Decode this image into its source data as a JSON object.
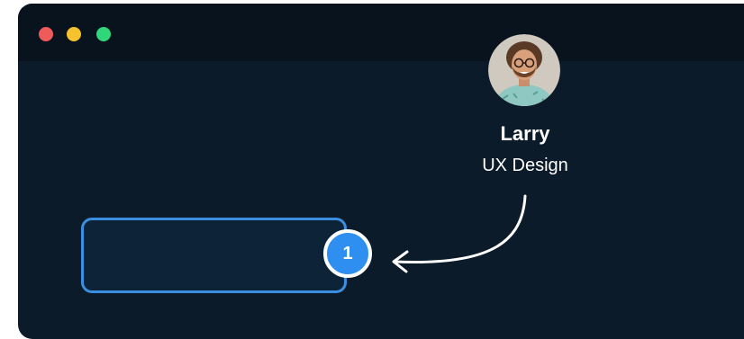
{
  "window": {
    "traffic_lights": [
      {
        "name": "close",
        "color": "#ef5a5a"
      },
      {
        "name": "minimize",
        "color": "#f6c22e"
      },
      {
        "name": "maximize",
        "color": "#2fd67a"
      }
    ],
    "background": "#0b1b2a",
    "titlebar_background": "#08131d"
  },
  "profile": {
    "name": "Larry",
    "role": "UX Design",
    "avatar_icon": "person-avatar"
  },
  "callout": {
    "step_number": "1",
    "badge_color": "#2f8ff0",
    "box_border_color": "#3b8fe0",
    "arrow_icon": "curved-arrow-left"
  }
}
